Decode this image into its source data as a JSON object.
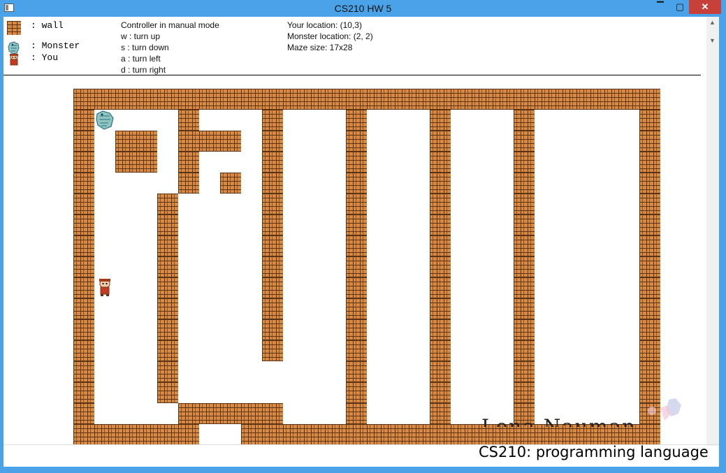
{
  "window": {
    "title": "CS210 HW 5",
    "minimize_glyph": "▔",
    "maximize_glyph": "▢",
    "close_glyph": "✕"
  },
  "legend": {
    "wall_label": ": wall",
    "monster_label": ": Monster",
    "you_label": ": You"
  },
  "controls": {
    "mode": "Controller in manual mode",
    "up": "w : turn up",
    "down": "s : turn down",
    "left": "a : turn left",
    "right": "d : turn right"
  },
  "status": {
    "your_location": "Your location: (10,3)",
    "monster_location": "Monster location: (2, 2)",
    "maze_size": "Maze size: 17x28"
  },
  "maze": {
    "rows": 17,
    "cols": 28,
    "grid": [
      "############################",
      "#M   #   #   #   #   #     #",
      "# ## ### #   #   #   #     #",
      "# ## #   #   #   #   #     #",
      "#    # # #   #   #   #     #",
      "#   #    #   #   #   #     #",
      "#   #    #   #   #   #     #",
      "#   #    #   #   #   #     #",
      "#   #    #   #   #   #     #",
      "#Y  #    #   #   #   #     #",
      "#   #    #   #   #   #     #",
      "#   #    #   #   #   #     #",
      "#   #    #   #   #   #     #",
      "#   #        #   #   #     #",
      "#   #        #   #   #     #",
      "#    #####   #   #   #     #",
      "######  ####################"
    ]
  },
  "overlay": {
    "watermark_name": "Lena Nauman",
    "course_caption": "CS210: programming language"
  },
  "colors": {
    "brick": "#d98a42",
    "mortar": "#5a3214",
    "titlebar": "#4aa3e8",
    "close": "#c7413a"
  }
}
